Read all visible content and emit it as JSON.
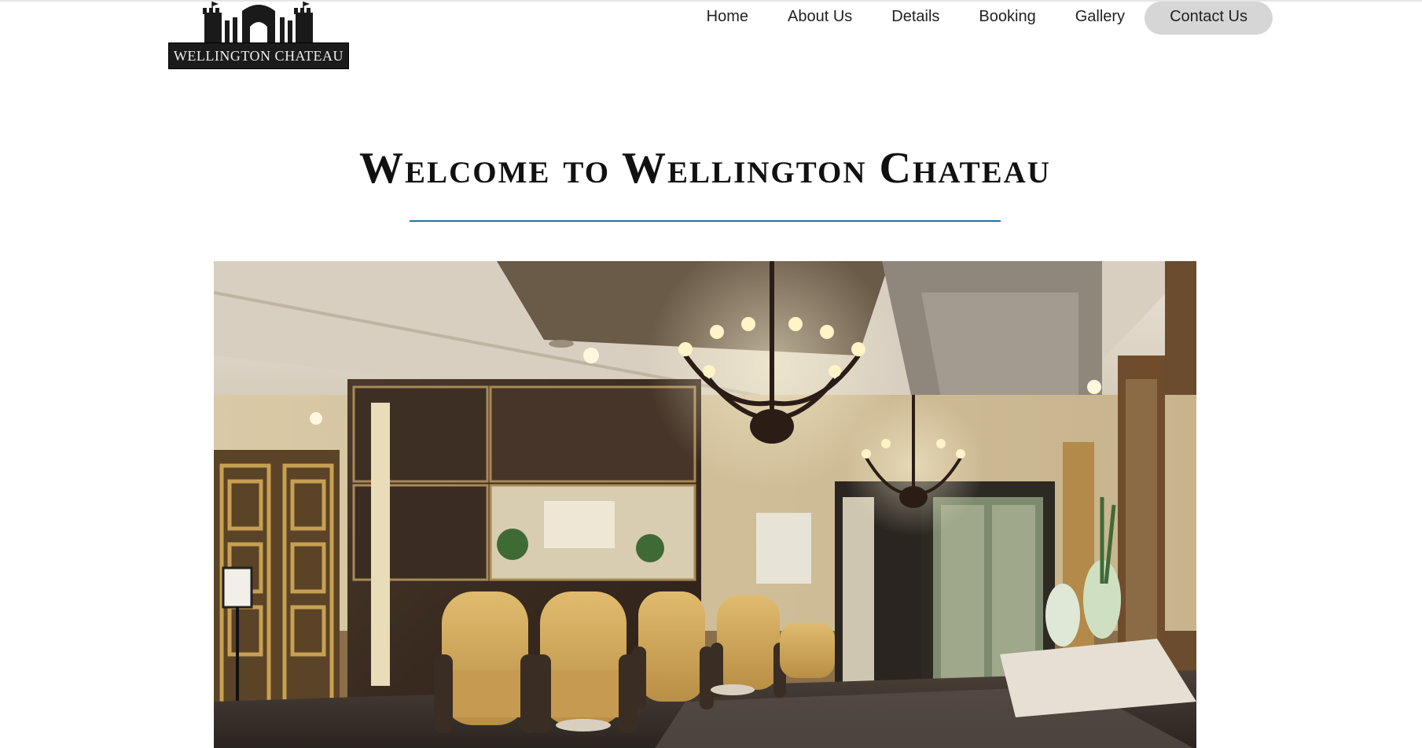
{
  "logo": {
    "text": "WELLINGTON CHATEAU",
    "icon": "castle-icon"
  },
  "nav": {
    "items": [
      {
        "label": "Home"
      },
      {
        "label": "About Us"
      },
      {
        "label": "Details"
      },
      {
        "label": "Booking"
      },
      {
        "label": "Gallery"
      },
      {
        "label": "Contact Us",
        "active": true
      }
    ]
  },
  "main": {
    "heading": "Welcome to Wellington Chateau",
    "hero_image": "hotel-lobby-photo"
  },
  "colors": {
    "divider": "#1f73a6",
    "active_nav_bg": "#d6d6d6",
    "logo_bg": "#1b1b1b"
  }
}
